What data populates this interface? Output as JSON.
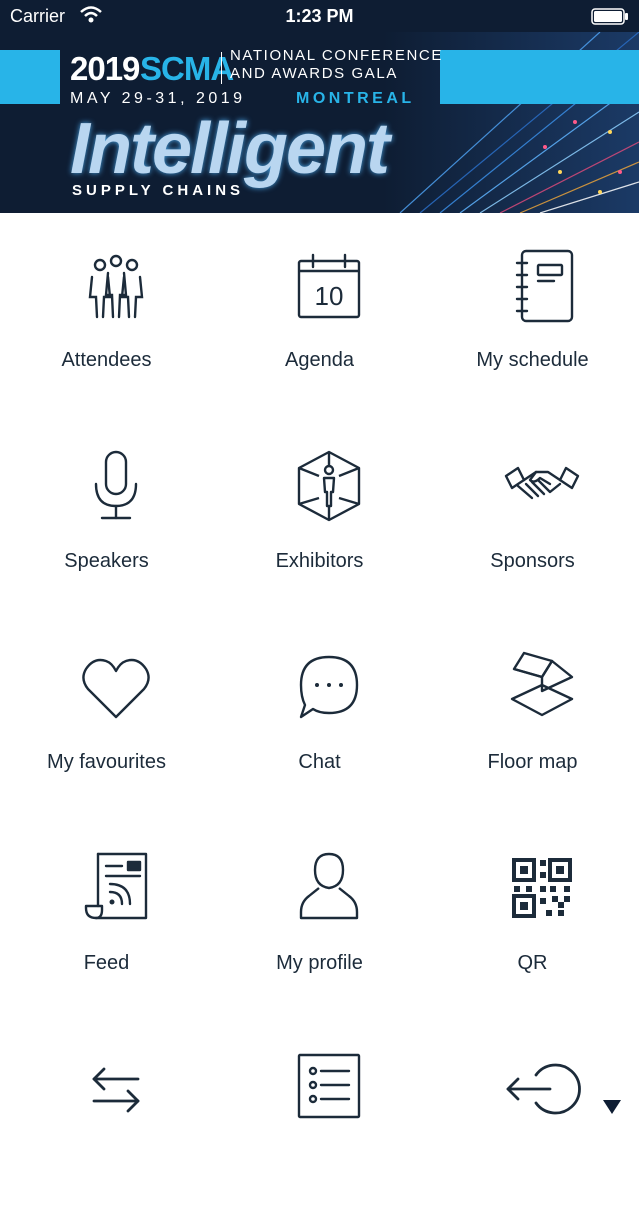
{
  "status_bar": {
    "carrier": "Carrier",
    "time": "1:23 PM"
  },
  "banner": {
    "year": "2019",
    "org": "SCMA",
    "conference_line1": "NATIONAL CONFERENCE",
    "conference_line2": "AND AWARDS GALA",
    "dates": "MAY 29-31, 2019",
    "city": "MONTREAL",
    "headline": "Intelligent",
    "tagline": "SUPPLY CHAINS",
    "colors": {
      "background": "#0e1d33",
      "accent": "#28b4e8"
    }
  },
  "menu": {
    "items": [
      {
        "label": "Attendees",
        "icon": "people-group-icon"
      },
      {
        "label": "Agenda",
        "icon": "calendar-icon"
      },
      {
        "label": "My schedule",
        "icon": "notebook-icon"
      },
      {
        "label": "Speakers",
        "icon": "microphone-icon"
      },
      {
        "label": "Exhibitors",
        "icon": "hexagon-person-icon"
      },
      {
        "label": "Sponsors",
        "icon": "handshake-icon"
      },
      {
        "label": "My favourites",
        "icon": "heart-icon"
      },
      {
        "label": "Chat",
        "icon": "chat-bubble-icon"
      },
      {
        "label": "Floor map",
        "icon": "layers-map-icon"
      },
      {
        "label": "Feed",
        "icon": "news-feed-icon"
      },
      {
        "label": "My profile",
        "icon": "user-icon"
      },
      {
        "label": "QR",
        "icon": "qr-code-icon"
      },
      {
        "label": "",
        "icon": "swap-arrows-icon"
      },
      {
        "label": "",
        "icon": "list-icon"
      },
      {
        "label": "",
        "icon": "logout-icon"
      }
    ],
    "icon_color": "#1c2b3a"
  }
}
